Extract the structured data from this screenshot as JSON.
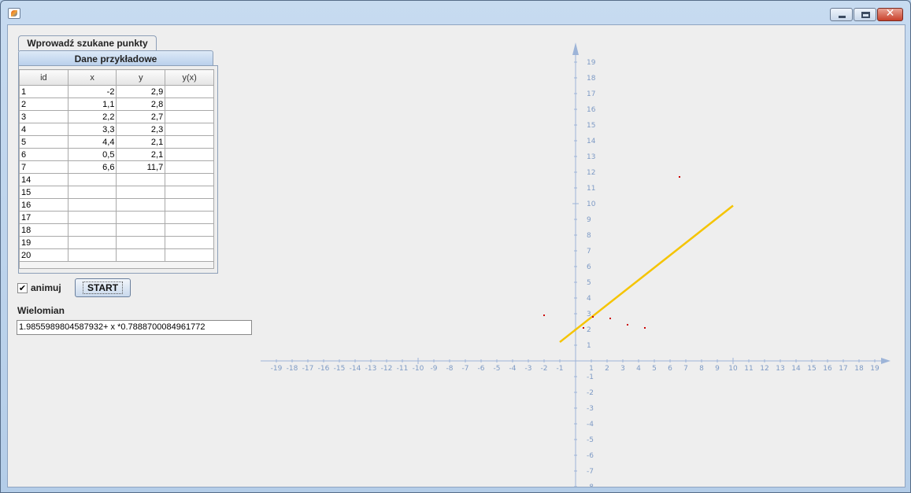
{
  "window": {
    "title": "",
    "controls": [
      "minimize-icon",
      "maximize-icon",
      "close-icon"
    ],
    "close_symbol": "✕"
  },
  "tabs": [
    {
      "label": "Wprowadź szukane punkty",
      "selected": false
    },
    {
      "label": "Dane przykładowe",
      "selected": true
    }
  ],
  "table": {
    "columns": [
      "id",
      "x",
      "y",
      "y(x)"
    ],
    "rows": [
      [
        "1",
        "-2",
        "2,9",
        ""
      ],
      [
        "2",
        "1,1",
        "2,8",
        ""
      ],
      [
        "3",
        "2,2",
        "2,7",
        ""
      ],
      [
        "4",
        "3,3",
        "2,3",
        ""
      ],
      [
        "5",
        "4,4",
        "2,1",
        ""
      ],
      [
        "6",
        "0,5",
        "2,1",
        ""
      ],
      [
        "7",
        "6,6",
        "11,7",
        ""
      ],
      [
        "14",
        "",
        "",
        ""
      ],
      [
        "15",
        "",
        "",
        ""
      ],
      [
        "16",
        "",
        "",
        ""
      ],
      [
        "17",
        "",
        "",
        ""
      ],
      [
        "18",
        "",
        "",
        ""
      ],
      [
        "19",
        "",
        "",
        ""
      ],
      [
        "20",
        "",
        "",
        ""
      ]
    ]
  },
  "controls": {
    "animate_label": "animuj",
    "animate_checked": true,
    "check_glyph": "✔",
    "start_label": "START",
    "polynomial_label": "Wielomian",
    "polynomial_value": "1.9855989804587932+ x *0.7888700084961772"
  },
  "chart_data": {
    "type": "scatter",
    "xlim": [
      -19,
      19
    ],
    "ylim": [
      -8,
      19
    ],
    "x_ticks": [
      -19,
      -18,
      -17,
      -16,
      -15,
      -14,
      -13,
      -12,
      -11,
      -10,
      -9,
      -8,
      -7,
      -6,
      -5,
      -4,
      -3,
      -2,
      -1,
      1,
      2,
      3,
      4,
      5,
      6,
      7,
      8,
      9,
      10,
      11,
      12,
      13,
      14,
      15,
      16,
      17,
      18,
      19
    ],
    "y_ticks": [
      -8,
      -7,
      -6,
      -5,
      -4,
      -3,
      -2,
      -1,
      1,
      2,
      3,
      4,
      5,
      6,
      7,
      8,
      9,
      10,
      11,
      12,
      13,
      14,
      15,
      16,
      17,
      18,
      19
    ],
    "points": [
      {
        "x": -2,
        "y": 2.9
      },
      {
        "x": 1.1,
        "y": 2.8
      },
      {
        "x": 2.2,
        "y": 2.7
      },
      {
        "x": 3.3,
        "y": 2.3
      },
      {
        "x": 4.4,
        "y": 2.1
      },
      {
        "x": 0.5,
        "y": 2.1
      },
      {
        "x": 6.6,
        "y": 11.7
      }
    ],
    "fit_line": {
      "x_start": -1,
      "x_end": 10,
      "intercept": 1.9855989804587932,
      "slope": 0.7888700084961772
    },
    "colors": {
      "axis": "#9db4d8",
      "tick_label": "#7d9ac5",
      "point": "#cc0000",
      "line": "#f5c400"
    }
  }
}
